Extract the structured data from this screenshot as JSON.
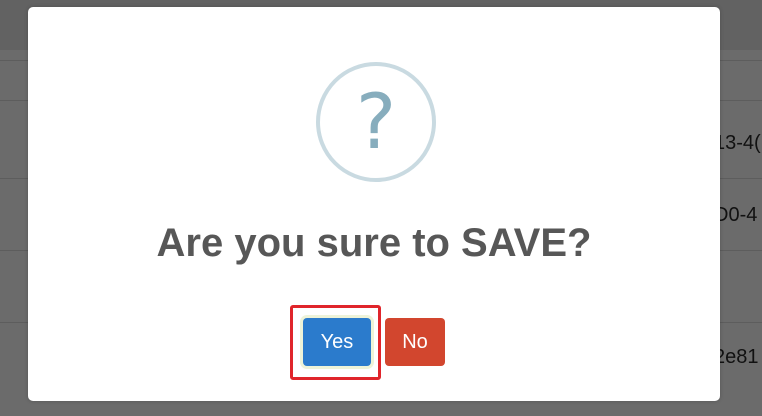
{
  "background": {
    "cells": [
      "13-4(",
      "D0-4",
      "2e81"
    ]
  },
  "dialog": {
    "icon": "question-mark-icon",
    "icon_glyph": "?",
    "title": "Are you sure to SAVE?",
    "confirm_label": "Yes",
    "cancel_label": "No"
  },
  "colors": {
    "overlay": "#6b6b6b",
    "dialog_bg": "#ffffff",
    "icon_ring": "#c9dae1",
    "icon_glyph": "#87adbd",
    "title_text": "#575757",
    "confirm_bg": "#2b7bcc",
    "cancel_bg": "#d2462e",
    "highlight": "#e0252b"
  }
}
